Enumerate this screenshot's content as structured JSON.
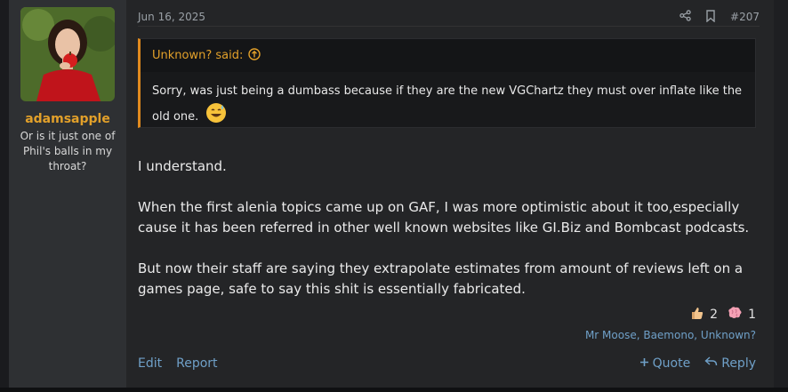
{
  "user": {
    "name": "adamsapple",
    "title": "Or is it just one of Phil's balls in my throat?"
  },
  "post": {
    "date": "Jun 16, 2025",
    "number": "#207"
  },
  "quote": {
    "author": "Unknown? said:",
    "text": "Sorry, was just being a dumbass because if they are the new VGChartz they must over inflate like the old one."
  },
  "message": {
    "paragraphs": [
      "I understand.",
      "When the first alenia topics came up on GAF, I was more optimistic about it too,especially cause it has been referred in other well known websites like GI.Biz and Bombcast podcasts.",
      "But now their staff are saying they extrapolate estimates from amount of reviews left on a games page, safe to say this shit is essentially fabricated."
    ]
  },
  "reactions": {
    "items": [
      {
        "icon": "thumbs-up-icon",
        "count": "2"
      },
      {
        "icon": "brain-icon",
        "count": "1"
      }
    ],
    "users": "Mr Moose, Baemono, Unknown?"
  },
  "actions": {
    "edit": "Edit",
    "report": "Report",
    "quote": "Quote",
    "reply": "Reply"
  },
  "colors": {
    "accent": "#e2a02a",
    "link": "#6fa0c8",
    "quote_border": "#e08a1e"
  }
}
